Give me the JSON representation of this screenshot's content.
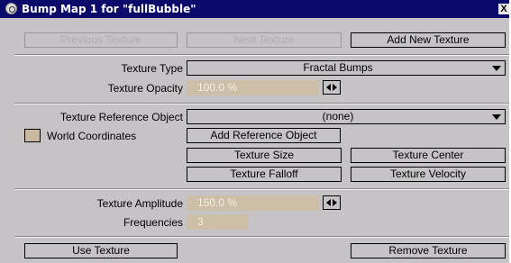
{
  "window": {
    "title": "Bump Map 1 for \"fullBubble\"",
    "close_glyph": "X",
    "icon": "bubble-icon"
  },
  "top_buttons": {
    "previous_texture": "Previous Texture",
    "next_texture": "Next Texture",
    "add_new_texture": "Add New Texture"
  },
  "texture": {
    "type_label": "Texture Type",
    "type_value": "Fractal Bumps",
    "opacity_label": "Texture Opacity",
    "opacity_value": "100.0 %"
  },
  "reference": {
    "object_label": "Texture Reference Object",
    "object_value": "(none)",
    "world_coords_label": "World Coordinates",
    "world_coords_checked": false,
    "add_reference_object": "Add Reference Object",
    "texture_size": "Texture Size",
    "texture_center": "Texture Center",
    "texture_falloff": "Texture Falloff",
    "texture_velocity": "Texture Velocity"
  },
  "amplitude": {
    "amplitude_label": "Texture Amplitude",
    "amplitude_value": "150.0 %",
    "frequencies_label": "Frequencies",
    "frequencies_value": "3"
  },
  "bottom_buttons": {
    "use_texture": "Use Texture",
    "remove_texture": "Remove Texture"
  },
  "colors": {
    "panel": "#c6c3c6",
    "titlebar": "#0a0a6a",
    "field": "#cdbfa7"
  }
}
